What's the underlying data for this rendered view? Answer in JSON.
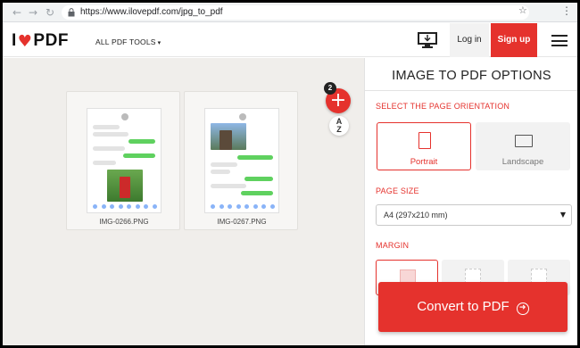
{
  "browser": {
    "back_icon": "←",
    "forward_icon": "→",
    "reload_icon": "↻",
    "url": "https://www.ilovepdf.com/jpg_to_pdf",
    "star_icon": "☆",
    "menu_icon": "⋮"
  },
  "header": {
    "logo_left": "I",
    "logo_heart": "♥",
    "logo_right": "PDF",
    "tools_label": "ALL PDF TOOLS",
    "tools_caret": "▾",
    "login_label": "Log in",
    "signup_label": "Sign up"
  },
  "workspace": {
    "file_count": "2",
    "add_icon": "+",
    "sort_label_top": "A",
    "sort_label_bottom": "Z",
    "files": [
      {
        "name": "IMG-0266.PNG"
      },
      {
        "name": "IMG-0267.PNG"
      }
    ]
  },
  "options": {
    "title": "IMAGE TO PDF OPTIONS",
    "orientation_label": "SELECT THE PAGE ORIENTATION",
    "portrait_label": "Portrait",
    "landscape_label": "Landscape",
    "page_size_label": "PAGE SIZE",
    "page_size_value": "A4 (297x210 mm)",
    "select_arrow": "▼",
    "margin_label": "MARGIN"
  },
  "convert": {
    "label": "Convert to PDF",
    "arrow_icon": "➜"
  },
  "colors": {
    "accent": "#e5322d"
  }
}
